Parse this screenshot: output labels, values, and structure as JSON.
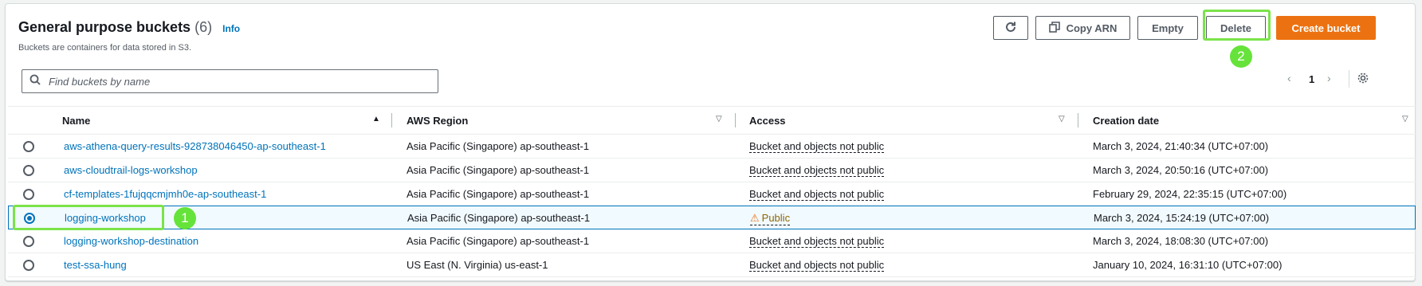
{
  "header": {
    "title": "General purpose buckets",
    "count": "(6)",
    "info_label": "Info",
    "description": "Buckets are containers for data stored in S3."
  },
  "toolbar": {
    "refresh_icon": "refresh-icon",
    "copy_arn_label": "Copy ARN",
    "copy_icon": "copy-icon",
    "empty_label": "Empty",
    "delete_label": "Delete",
    "create_label": "Create bucket"
  },
  "search": {
    "placeholder": "Find buckets by name",
    "value": ""
  },
  "pagination": {
    "current_page": "1"
  },
  "table": {
    "columns": [
      "Name",
      "AWS Region",
      "Access",
      "Creation date"
    ],
    "rows": [
      {
        "name": "aws-athena-query-results-928738046450-ap-southeast-1",
        "region": "Asia Pacific (Singapore) ap-southeast-1",
        "access": "Bucket and objects not public",
        "created": "March 3, 2024, 21:40:34 (UTC+07:00)",
        "selected": false
      },
      {
        "name": "aws-cloudtrail-logs-workshop",
        "region": "Asia Pacific (Singapore) ap-southeast-1",
        "access": "Bucket and objects not public",
        "created": "March 3, 2024, 20:50:16 (UTC+07:00)",
        "selected": false
      },
      {
        "name": "cf-templates-1fujqqcmjmh0e-ap-southeast-1",
        "region": "Asia Pacific (Singapore) ap-southeast-1",
        "access": "Bucket and objects not public",
        "created": "February 29, 2024, 22:35:15 (UTC+07:00)",
        "selected": false
      },
      {
        "name": "logging-workshop",
        "region": "Asia Pacific (Singapore) ap-southeast-1",
        "access": "Public",
        "created": "March 3, 2024, 15:24:19 (UTC+07:00)",
        "selected": true
      },
      {
        "name": "logging-workshop-destination",
        "region": "Asia Pacific (Singapore) ap-southeast-1",
        "access": "Bucket and objects not public",
        "created": "March 3, 2024, 18:08:30 (UTC+07:00)",
        "selected": false
      },
      {
        "name": "test-ssa-hung",
        "region": "US East (N. Virginia) us-east-1",
        "access": "Bucket and objects not public",
        "created": "January 10, 2024, 16:31:10 (UTC+07:00)",
        "selected": false
      }
    ]
  },
  "annotations": [
    "1",
    "2"
  ],
  "colors": {
    "accent": "#0073bb",
    "primary_button": "#ec7211",
    "highlight": "#7be34a",
    "public_text": "#8d6605"
  }
}
